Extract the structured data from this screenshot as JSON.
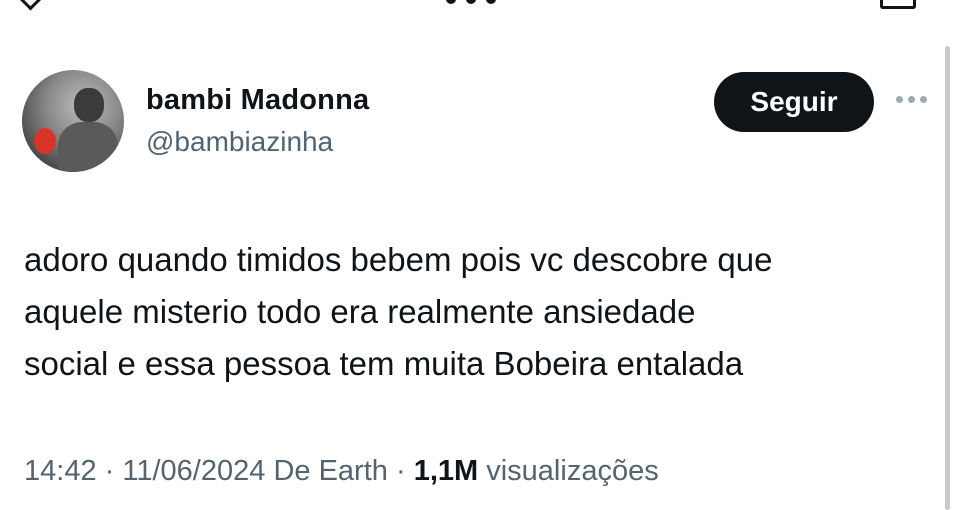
{
  "author": {
    "display_name": "bambi Madonna",
    "handle": "@bambiazinha"
  },
  "actions": {
    "follow_label": "Seguir",
    "more_icon": "more-horizontal-icon"
  },
  "tweet": {
    "lines": [
      "adoro quando timidos bebem pois vc descobre que",
      "aquele misterio todo era realmente ansiedade",
      "social e essa pessoa tem muita Bobeira entalada"
    ]
  },
  "meta": {
    "time": "14:42",
    "separator": "·",
    "date": "11/06/2024",
    "source": "De Earth",
    "views_count": "1,1M",
    "views_label": "visualizações"
  },
  "colors": {
    "text_primary": "#0f1419",
    "text_secondary": "#536471",
    "button_bg": "#0f1419",
    "button_text": "#ffffff"
  }
}
